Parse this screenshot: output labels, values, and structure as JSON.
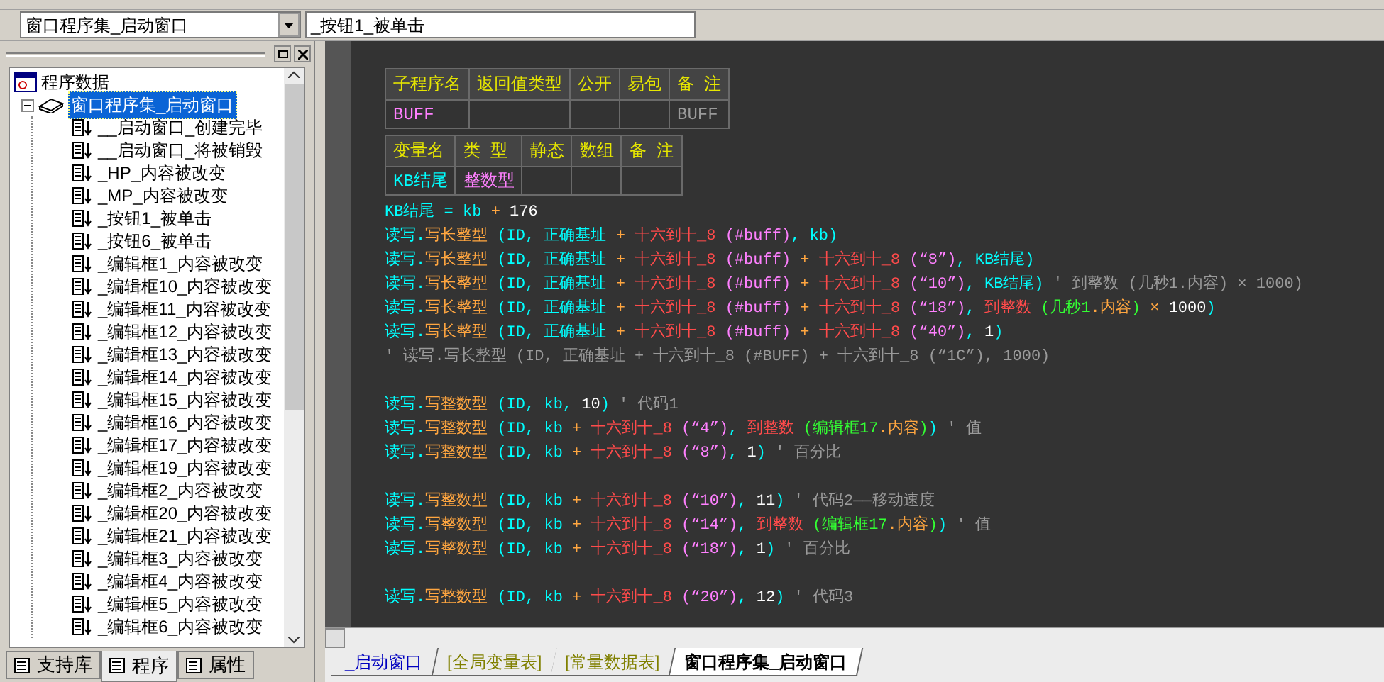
{
  "toolbar": {
    "module_combo": "窗口程序集_启动窗口",
    "method_combo": "_按钮1_被单击"
  },
  "tree": {
    "root": "程序数据",
    "children": [
      {
        "label": "窗口程序集_启动窗口",
        "selected": true,
        "children": [
          {
            "label": "__启动窗口_创建完毕",
            "selected": false
          },
          {
            "label": "__启动窗口_将被销毁",
            "selected": false
          },
          {
            "label": "_HP_内容被改变",
            "selected": false
          },
          {
            "label": "_MP_内容被改变",
            "selected": false
          },
          {
            "label": "_按钮1_被单击",
            "selected": false
          },
          {
            "label": "_按钮6_被单击",
            "selected": false
          },
          {
            "label": "_编辑框1_内容被改变",
            "selected": false
          },
          {
            "label": "_编辑框10_内容被改变",
            "selected": false
          },
          {
            "label": "_编辑框11_内容被改变",
            "selected": false
          },
          {
            "label": "_编辑框12_内容被改变",
            "selected": false
          },
          {
            "label": "_编辑框13_内容被改变",
            "selected": false
          },
          {
            "label": "_编辑框14_内容被改变",
            "selected": false
          },
          {
            "label": "_编辑框15_内容被改变",
            "selected": false
          },
          {
            "label": "_编辑框16_内容被改变",
            "selected": false
          },
          {
            "label": "_编辑框17_内容被改变",
            "selected": false
          },
          {
            "label": "_编辑框19_内容被改变",
            "selected": false
          },
          {
            "label": "_编辑框2_内容被改变",
            "selected": false
          },
          {
            "label": "_编辑框20_内容被改变",
            "selected": false
          },
          {
            "label": "_编辑框21_内容被改变",
            "selected": false
          },
          {
            "label": "_编辑框3_内容被改变",
            "selected": false
          },
          {
            "label": "_编辑框4_内容被改变",
            "selected": false
          },
          {
            "label": "_编辑框5_内容被改变",
            "selected": false
          },
          {
            "label": "_编辑框6_内容被改变",
            "selected": false
          }
        ]
      }
    ]
  },
  "panel_tabs": [
    {
      "label": "支持库",
      "selected": false
    },
    {
      "label": "程序",
      "selected": true
    },
    {
      "label": "属性",
      "selected": false
    }
  ],
  "sub_table": {
    "columns": [
      "子程序名",
      "返回值类型",
      "公开",
      "易包",
      "备 注"
    ],
    "row": [
      {
        "text": "BUFF",
        "kind": "constant"
      },
      {
        "kind": "empty"
      },
      {
        "kind": "empty"
      },
      {
        "kind": "empty"
      },
      {
        "text": "BUFF",
        "kind": "comment"
      }
    ]
  },
  "var_table": {
    "columns": [
      "变量名",
      "类 型",
      "静态",
      "数组",
      "备 注"
    ],
    "row": [
      {
        "text": "KB结尾",
        "kind": "name"
      },
      {
        "text": "整数型",
        "kind": "constant"
      },
      {
        "kind": "empty"
      },
      {
        "kind": "empty"
      },
      {
        "kind": "empty"
      }
    ]
  },
  "code_lines": [
    {
      "kind": "code",
      "tokens": [
        {
          "kind": "name",
          "text": "KB结尾 = kb "
        },
        {
          "kind": "operator",
          "text": "+ "
        },
        {
          "kind": "literal",
          "text": "176"
        }
      ]
    },
    {
      "kind": "code",
      "tokens": [
        {
          "kind": "name",
          "text": "读写."
        },
        {
          "kind": "method",
          "text": "写长整型"
        },
        {
          "kind": "name",
          "text": " (ID, 正确基址 "
        },
        {
          "kind": "operator",
          "text": "+ "
        },
        {
          "kind": "command",
          "text": "十六到十_8 "
        },
        {
          "kind": "constant",
          "text": "(#buff)"
        },
        {
          "kind": "name",
          "text": ", kb)"
        }
      ]
    },
    {
      "kind": "code",
      "tokens": [
        {
          "kind": "name",
          "text": "读写."
        },
        {
          "kind": "method",
          "text": "写长整型"
        },
        {
          "kind": "name",
          "text": " (ID, 正确基址 "
        },
        {
          "kind": "operator",
          "text": "+ "
        },
        {
          "kind": "command",
          "text": "十六到十_8 "
        },
        {
          "kind": "constant",
          "text": "(#buff) "
        },
        {
          "kind": "operator",
          "text": "+ "
        },
        {
          "kind": "command",
          "text": "十六到十_8 "
        },
        {
          "kind": "constant",
          "text": "(“8”)"
        },
        {
          "kind": "name",
          "text": ", KB结尾)"
        }
      ]
    },
    {
      "kind": "code",
      "tokens": [
        {
          "kind": "name",
          "text": "读写."
        },
        {
          "kind": "method",
          "text": "写长整型"
        },
        {
          "kind": "name",
          "text": " (ID, 正确基址 "
        },
        {
          "kind": "operator",
          "text": "+ "
        },
        {
          "kind": "command",
          "text": "十六到十_8 "
        },
        {
          "kind": "constant",
          "text": "(#buff) "
        },
        {
          "kind": "operator",
          "text": "+ "
        },
        {
          "kind": "command",
          "text": "十六到十_8 "
        },
        {
          "kind": "constant",
          "text": "(“10”)"
        },
        {
          "kind": "name",
          "text": ", KB结尾)"
        },
        {
          "kind": "comment",
          "text": " ' 到整数 (几秒1.内容) × 1000)"
        }
      ]
    },
    {
      "kind": "code",
      "tokens": [
        {
          "kind": "name",
          "text": "读写."
        },
        {
          "kind": "method",
          "text": "写长整型"
        },
        {
          "kind": "name",
          "text": " (ID, 正确基址 "
        },
        {
          "kind": "operator",
          "text": "+ "
        },
        {
          "kind": "command",
          "text": "十六到十_8 "
        },
        {
          "kind": "constant",
          "text": "(#buff) "
        },
        {
          "kind": "operator",
          "text": "+ "
        },
        {
          "kind": "command",
          "text": "十六到十_8 "
        },
        {
          "kind": "constant",
          "text": "(“18”)"
        },
        {
          "kind": "name",
          "text": ", "
        },
        {
          "kind": "command",
          "text": "到整数 "
        },
        {
          "kind": "control",
          "text": "(几秒1"
        },
        {
          "kind": "method",
          "text": ".内容"
        },
        {
          "kind": "control",
          "text": ")"
        },
        {
          "kind": "operator",
          "text": " × "
        },
        {
          "kind": "literal",
          "text": "1000"
        },
        {
          "kind": "name",
          "text": ")"
        }
      ]
    },
    {
      "kind": "code",
      "tokens": [
        {
          "kind": "name",
          "text": "读写."
        },
        {
          "kind": "method",
          "text": "写长整型"
        },
        {
          "kind": "name",
          "text": " (ID, 正确基址 "
        },
        {
          "kind": "operator",
          "text": "+ "
        },
        {
          "kind": "command",
          "text": "十六到十_8 "
        },
        {
          "kind": "constant",
          "text": "(#buff) "
        },
        {
          "kind": "operator",
          "text": "+ "
        },
        {
          "kind": "command",
          "text": "十六到十_8 "
        },
        {
          "kind": "constant",
          "text": "(“40”)"
        },
        {
          "kind": "name",
          "text": ", "
        },
        {
          "kind": "literal",
          "text": "1"
        },
        {
          "kind": "name",
          "text": ")"
        }
      ]
    },
    {
      "kind": "code",
      "tokens": [
        {
          "kind": "comment",
          "text": "' 读写.写长整型 (ID, 正确基址 + 十六到十_8 (#BUFF) + 十六到十_8 (“1C”), 1000)"
        }
      ]
    },
    {
      "kind": "blank"
    },
    {
      "kind": "code",
      "tokens": [
        {
          "kind": "name",
          "text": "读写."
        },
        {
          "kind": "method",
          "text": "写整数型"
        },
        {
          "kind": "name",
          "text": " (ID, kb, "
        },
        {
          "kind": "literal",
          "text": "10"
        },
        {
          "kind": "name",
          "text": ")"
        },
        {
          "kind": "comment",
          "text": " ' 代码1"
        }
      ]
    },
    {
      "kind": "code",
      "tokens": [
        {
          "kind": "name",
          "text": "读写."
        },
        {
          "kind": "method",
          "text": "写整数型"
        },
        {
          "kind": "name",
          "text": " (ID, kb "
        },
        {
          "kind": "operator",
          "text": "+ "
        },
        {
          "kind": "command",
          "text": "十六到十_8 "
        },
        {
          "kind": "constant",
          "text": "(“4”)"
        },
        {
          "kind": "name",
          "text": ", "
        },
        {
          "kind": "command",
          "text": "到整数 "
        },
        {
          "kind": "control",
          "text": "(编辑框17"
        },
        {
          "kind": "method",
          "text": ".内容"
        },
        {
          "kind": "control",
          "text": ")"
        },
        {
          "kind": "name",
          "text": ")"
        },
        {
          "kind": "comment",
          "text": " ' 值"
        }
      ]
    },
    {
      "kind": "code",
      "tokens": [
        {
          "kind": "name",
          "text": "读写."
        },
        {
          "kind": "method",
          "text": "写整数型"
        },
        {
          "kind": "name",
          "text": " (ID, kb "
        },
        {
          "kind": "operator",
          "text": "+ "
        },
        {
          "kind": "command",
          "text": "十六到十_8 "
        },
        {
          "kind": "constant",
          "text": "(“8”)"
        },
        {
          "kind": "name",
          "text": ", "
        },
        {
          "kind": "literal",
          "text": "1"
        },
        {
          "kind": "name",
          "text": ")"
        },
        {
          "kind": "comment",
          "text": " ' 百分比"
        }
      ]
    },
    {
      "kind": "blank"
    },
    {
      "kind": "code",
      "tokens": [
        {
          "kind": "name",
          "text": "读写."
        },
        {
          "kind": "method",
          "text": "写整数型"
        },
        {
          "kind": "name",
          "text": " (ID, kb "
        },
        {
          "kind": "operator",
          "text": "+ "
        },
        {
          "kind": "command",
          "text": "十六到十_8 "
        },
        {
          "kind": "constant",
          "text": "(“10”)"
        },
        {
          "kind": "name",
          "text": ", "
        },
        {
          "kind": "literal",
          "text": "11"
        },
        {
          "kind": "name",
          "text": ")"
        },
        {
          "kind": "comment",
          "text": " ' 代码2——移动速度"
        }
      ]
    },
    {
      "kind": "code",
      "tokens": [
        {
          "kind": "name",
          "text": "读写."
        },
        {
          "kind": "method",
          "text": "写整数型"
        },
        {
          "kind": "name",
          "text": " (ID, kb "
        },
        {
          "kind": "operator",
          "text": "+ "
        },
        {
          "kind": "command",
          "text": "十六到十_8 "
        },
        {
          "kind": "constant",
          "text": "(“14”)"
        },
        {
          "kind": "name",
          "text": ", "
        },
        {
          "kind": "command",
          "text": "到整数 "
        },
        {
          "kind": "control",
          "text": "(编辑框17"
        },
        {
          "kind": "method",
          "text": ".内容"
        },
        {
          "kind": "control",
          "text": ")"
        },
        {
          "kind": "name",
          "text": ")"
        },
        {
          "kind": "comment",
          "text": " ' 值"
        }
      ]
    },
    {
      "kind": "code",
      "tokens": [
        {
          "kind": "name",
          "text": "读写."
        },
        {
          "kind": "method",
          "text": "写整数型"
        },
        {
          "kind": "name",
          "text": " (ID, kb "
        },
        {
          "kind": "operator",
          "text": "+ "
        },
        {
          "kind": "command",
          "text": "十六到十_8 "
        },
        {
          "kind": "constant",
          "text": "(“18”)"
        },
        {
          "kind": "name",
          "text": ", "
        },
        {
          "kind": "literal",
          "text": "1"
        },
        {
          "kind": "name",
          "text": ")"
        },
        {
          "kind": "comment",
          "text": " ' 百分比"
        }
      ]
    },
    {
      "kind": "blank"
    },
    {
      "kind": "code",
      "tokens": [
        {
          "kind": "name",
          "text": "读写."
        },
        {
          "kind": "method",
          "text": "写整数型"
        },
        {
          "kind": "name",
          "text": " (ID, kb "
        },
        {
          "kind": "operator",
          "text": "+ "
        },
        {
          "kind": "command",
          "text": "十六到十_8 "
        },
        {
          "kind": "constant",
          "text": "(“20”)"
        },
        {
          "kind": "name",
          "text": ", "
        },
        {
          "kind": "literal",
          "text": "12"
        },
        {
          "kind": "name",
          "text": ")"
        },
        {
          "kind": "comment",
          "text": " ' 代码3"
        }
      ]
    }
  ],
  "editor_tabs": [
    {
      "label": "_启动窗口",
      "kind": "window",
      "selected": false
    },
    {
      "label": "[全局变量表]",
      "kind": "table",
      "selected": false
    },
    {
      "label": "[常量数据表]",
      "kind": "table",
      "selected": false
    },
    {
      "label": "窗口程序集_启动窗口",
      "kind": "module",
      "selected": true
    }
  ]
}
